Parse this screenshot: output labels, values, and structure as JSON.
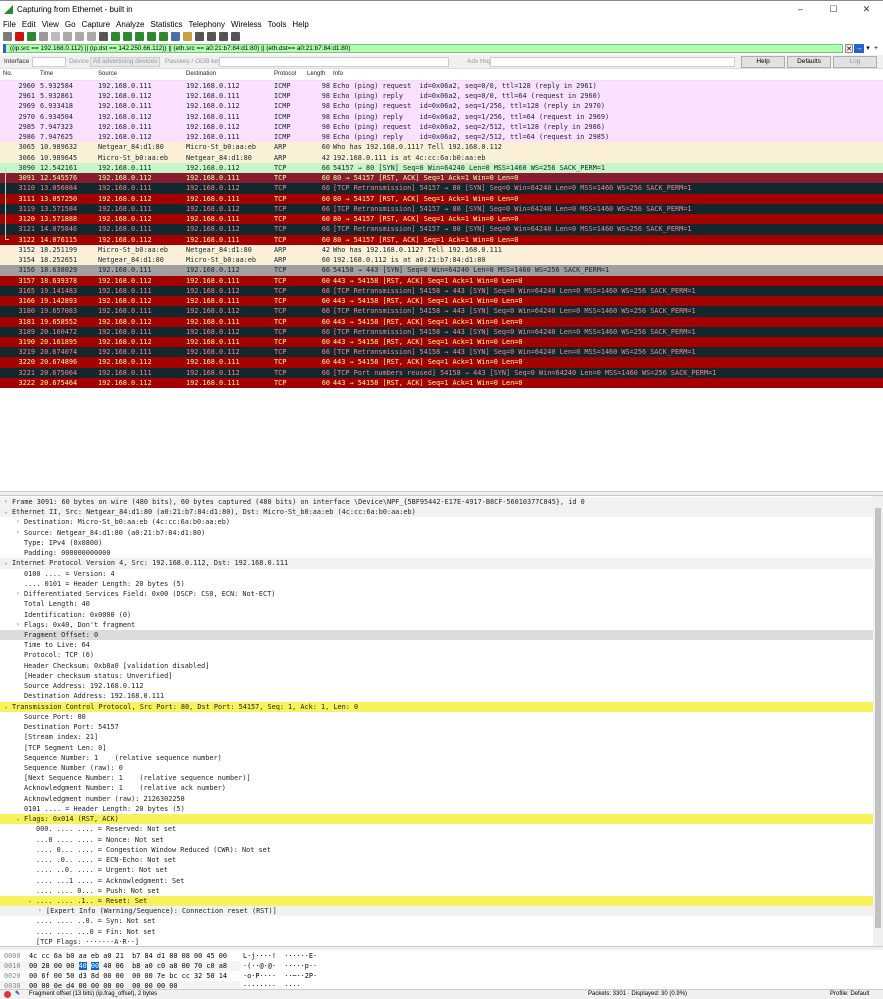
{
  "window": {
    "title": "Capturing from Ethernet - built in",
    "minimize": "–",
    "maximize": "☐",
    "close": "✕"
  },
  "menu": [
    "File",
    "Edit",
    "View",
    "Go",
    "Capture",
    "Analyze",
    "Statistics",
    "Telephony",
    "Wireless",
    "Tools",
    "Help"
  ],
  "toolbar_icons": [
    "shark-fin-start-icon",
    "stop-icon",
    "restart-icon",
    "options-icon",
    "open-icon",
    "save-icon",
    "close-file-icon",
    "reload-icon",
    "find-icon",
    "back-icon",
    "forward-icon",
    "go-to-packet-icon",
    "first-packet-icon",
    "last-packet-icon",
    "autoscroll-icon",
    "colorize-icon",
    "zoom-in-icon",
    "zoom-out-icon",
    "normal-size-icon",
    "resize-columns-icon"
  ],
  "filter": {
    "value": "((ip.src == 192.168.0.112) || (ip.dst == 142.250.66.112)) || (eth.src == a0:21:b7:84:d1:80) || (eth.dst== a0:21:b7:84:d1:80)",
    "clear": "✕",
    "apply": "→",
    "dropdown": "▾",
    "add": "+"
  },
  "interface_bar": {
    "interface_label": "Interface",
    "device_label": "Device",
    "device_value": "All advertising devices",
    "passkey_label": "Passkey / OOB key",
    "adv_hop_label": "Adv Hop",
    "help": "Help",
    "defaults": "Defaults",
    "log": "Log"
  },
  "columns": [
    "No.",
    "Time",
    "Source",
    "Destination",
    "Protocol",
    "Length",
    "Info"
  ],
  "packets": [
    {
      "no": "2960",
      "time": "5.932584",
      "src": "192.168.0.111",
      "dst": "192.168.0.112",
      "proto": "ICMP",
      "len": "98",
      "info": "Echo (ping) request  id=0x06a2, seq=0/0, ttl=128 (reply in 2961)",
      "type": "icmp"
    },
    {
      "no": "2961",
      "time": "5.932861",
      "src": "192.168.0.112",
      "dst": "192.168.0.111",
      "proto": "ICMP",
      "len": "98",
      "info": "Echo (ping) reply    id=0x06a2, seq=0/0, ttl=64 (request in 2960)",
      "type": "icmp"
    },
    {
      "no": "2969",
      "time": "6.933418",
      "src": "192.168.0.111",
      "dst": "192.168.0.112",
      "proto": "ICMP",
      "len": "98",
      "info": "Echo (ping) request  id=0x06a2, seq=1/256, ttl=128 (reply in 2970)",
      "type": "icmp"
    },
    {
      "no": "2970",
      "time": "6.934504",
      "src": "192.168.0.112",
      "dst": "192.168.0.111",
      "proto": "ICMP",
      "len": "98",
      "info": "Echo (ping) reply    id=0x06a2, seq=1/256, ttl=64 (request in 2969)",
      "type": "icmp"
    },
    {
      "no": "2985",
      "time": "7.947323",
      "src": "192.168.0.111",
      "dst": "192.168.0.112",
      "proto": "ICMP",
      "len": "98",
      "info": "Echo (ping) request  id=0x06a2, seq=2/512, ttl=128 (reply in 2986)",
      "type": "icmp"
    },
    {
      "no": "2986",
      "time": "7.947625",
      "src": "192.168.0.112",
      "dst": "192.168.0.111",
      "proto": "ICMP",
      "len": "98",
      "info": "Echo (ping) reply    id=0x06a2, seq=2/512, ttl=64 (request in 2985)",
      "type": "icmp"
    },
    {
      "no": "3065",
      "time": "10.989632",
      "src": "Netgear_84:d1:80",
      "dst": "Micro-St_b0:aa:eb",
      "proto": "ARP",
      "len": "60",
      "info": "Who has 192.168.0.111? Tell 192.168.0.112",
      "type": "arp"
    },
    {
      "no": "3066",
      "time": "10.989645",
      "src": "Micro-St_b0:aa:eb",
      "dst": "Netgear_84:d1:80",
      "proto": "ARP",
      "len": "42",
      "info": "192.168.0.111 is at 4c:cc:6a:b0:aa:eb",
      "type": "arp"
    },
    {
      "no": "3090",
      "time": "12.542161",
      "src": "192.168.0.111",
      "dst": "192.168.0.112",
      "proto": "TCP",
      "len": "66",
      "info": "54157 → 80 [SYN] Seq=0 Win=64240 Len=0 MSS=1460 WS=256 SACK_PERM=1",
      "type": "syn"
    },
    {
      "no": "3091",
      "time": "12.545576",
      "src": "192.168.0.112",
      "dst": "192.168.0.111",
      "proto": "TCP",
      "len": "60",
      "info": "80 → 54157 [RST, ACK] Seq=1 Ack=1 Win=0 Len=0",
      "type": "sel"
    },
    {
      "no": "3110",
      "time": "13.056884",
      "src": "192.168.0.111",
      "dst": "192.168.0.112",
      "proto": "TCP",
      "len": "66",
      "info": "[TCP Retransmission] 54157 → 80 [SYN] Seq=0 Win=64240 Len=0 MSS=1460 WS=256 SACK_PERM=1",
      "type": "retr"
    },
    {
      "no": "3111",
      "time": "13.057250",
      "src": "192.168.0.112",
      "dst": "192.168.0.111",
      "proto": "TCP",
      "len": "60",
      "info": "80 → 54157 [RST, ACK] Seq=1 Ack=1 Win=0 Len=0",
      "type": "rst"
    },
    {
      "no": "3119",
      "time": "13.571584",
      "src": "192.168.0.111",
      "dst": "192.168.0.112",
      "proto": "TCP",
      "len": "66",
      "info": "[TCP Retransmission] 54157 → 80 [SYN] Seq=0 Win=64240 Len=0 MSS=1460 WS=256 SACK_PERM=1",
      "type": "retr"
    },
    {
      "no": "3120",
      "time": "13.571888",
      "src": "192.168.0.112",
      "dst": "192.168.0.111",
      "proto": "TCP",
      "len": "60",
      "info": "80 → 54157 [RST, ACK] Seq=1 Ack=1 Win=0 Len=0",
      "type": "rst"
    },
    {
      "no": "3121",
      "time": "14.075846",
      "src": "192.168.0.111",
      "dst": "192.168.0.112",
      "proto": "TCP",
      "len": "66",
      "info": "[TCP Retransmission] 54157 → 80 [SYN] Seq=0 Win=64240 Len=0 MSS=1460 WS=256 SACK_PERM=1",
      "type": "retr"
    },
    {
      "no": "3122",
      "time": "14.076115",
      "src": "192.168.0.112",
      "dst": "192.168.0.111",
      "proto": "TCP",
      "len": "60",
      "info": "80 → 54157 [RST, ACK] Seq=1 Ack=1 Win=0 Len=0",
      "type": "rst"
    },
    {
      "no": "3152",
      "time": "18.251199",
      "src": "Micro-St_b0:aa:eb",
      "dst": "Netgear_84:d1:80",
      "proto": "ARP",
      "len": "42",
      "info": "Who has 192.168.0.112? Tell 192.168.0.111",
      "type": "arp"
    },
    {
      "no": "3154",
      "time": "18.252651",
      "src": "Netgear_84:d1:80",
      "dst": "Micro-St_b0:aa:eb",
      "proto": "ARP",
      "len": "60",
      "info": "192.168.0.112 is at a0:21:b7:84:d1:80",
      "type": "arp"
    },
    {
      "no": "3156",
      "time": "18.638029",
      "src": "192.168.0.111",
      "dst": "192.168.0.112",
      "proto": "TCP",
      "len": "66",
      "info": "54158 → 443 [SYN] Seq=0 Win=64240 Len=0 MSS=1460 WS=256 SACK_PERM=1",
      "type": "grey"
    },
    {
      "no": "3157",
      "time": "18.639378",
      "src": "192.168.0.112",
      "dst": "192.168.0.111",
      "proto": "TCP",
      "len": "60",
      "info": "443 → 54158 [RST, ACK] Seq=1 Ack=1 Win=0 Len=0",
      "type": "rst"
    },
    {
      "no": "3165",
      "time": "19.141483",
      "src": "192.168.0.111",
      "dst": "192.168.0.112",
      "proto": "TCP",
      "len": "66",
      "info": "[TCP Retransmission] 54158 → 443 [SYN] Seq=0 Win=64240 Len=0 MSS=1460 WS=256 SACK_PERM=1",
      "type": "retr"
    },
    {
      "no": "3166",
      "time": "19.142893",
      "src": "192.168.0.112",
      "dst": "192.168.0.111",
      "proto": "TCP",
      "len": "60",
      "info": "443 → 54158 [RST, ACK] Seq=1 Ack=1 Win=0 Len=0",
      "type": "rst"
    },
    {
      "no": "3180",
      "time": "19.657083",
      "src": "192.168.0.111",
      "dst": "192.168.0.112",
      "proto": "TCP",
      "len": "66",
      "info": "[TCP Retransmission] 54158 → 443 [SYN] Seq=0 Win=64240 Len=0 MSS=1460 WS=256 SACK_PERM=1",
      "type": "retr"
    },
    {
      "no": "3181",
      "time": "19.658552",
      "src": "192.168.0.112",
      "dst": "192.168.0.111",
      "proto": "TCP",
      "len": "60",
      "info": "443 → 54158 [RST, ACK] Seq=1 Ack=1 Win=0 Len=0",
      "type": "rst"
    },
    {
      "no": "3189",
      "time": "20.160472",
      "src": "192.168.0.111",
      "dst": "192.168.0.112",
      "proto": "TCP",
      "len": "66",
      "info": "[TCP Retransmission] 54158 → 443 [SYN] Seq=0 Win=64240 Len=0 MSS=1460 WS=256 SACK_PERM=1",
      "type": "retr"
    },
    {
      "no": "3190",
      "time": "20.161895",
      "src": "192.168.0.112",
      "dst": "192.168.0.111",
      "proto": "TCP",
      "len": "60",
      "info": "443 → 54158 [RST, ACK] Seq=1 Ack=1 Win=0 Len=0",
      "type": "rst"
    },
    {
      "no": "3219",
      "time": "20.674074",
      "src": "192.168.0.111",
      "dst": "192.168.0.112",
      "proto": "TCP",
      "len": "66",
      "info": "[TCP Retransmission] 54158 → 443 [SYN] Seq=0 Win=64240 Len=0 MSS=1460 WS=256 SACK_PERM=1",
      "type": "retr"
    },
    {
      "no": "3220",
      "time": "20.674896",
      "src": "192.168.0.112",
      "dst": "192.168.0.111",
      "proto": "TCP",
      "len": "60",
      "info": "443 → 54158 [RST, ACK] Seq=1 Ack=1 Win=0 Len=0",
      "type": "rst"
    },
    {
      "no": "3221",
      "time": "20.675064",
      "src": "192.168.0.111",
      "dst": "192.168.0.112",
      "proto": "TCP",
      "len": "66",
      "info": "[TCP Port numbers reused] 54158 → 443 [SYN] Seq=0 Win=64240 Len=0 MSS=1460 WS=256 SACK_PERM=1",
      "type": "retr"
    },
    {
      "no": "3222",
      "time": "20.675464",
      "src": "192.168.0.112",
      "dst": "192.168.0.111",
      "proto": "TCP",
      "len": "60",
      "info": "443 → 54158 [RST, ACK] Seq=1 Ack=1 Win=0 Len=0",
      "type": "rst"
    }
  ],
  "details": [
    {
      "text": "Frame 3091: 60 bytes on wire (480 bits), 60 bytes captured (480 bits) on interface \\Device\\NPF_{5BF95442-E17E-4917-B8CF-56010377C845}, id 0",
      "level": 0,
      "exp": ">",
      "style": "hdr"
    },
    {
      "text": "Ethernet II, Src: Netgear_84:d1:80 (a0:21:b7:84:d1:80), Dst: Micro-St_b0:aa:eb (4c:cc:6a:b0:aa:eb)",
      "level": 0,
      "exp": "v",
      "style": "hdr"
    },
    {
      "text": "Destination: Micro-St_b0:aa:eb (4c:cc:6a:b0:aa:eb)",
      "level": 1,
      "exp": ">"
    },
    {
      "text": "Source: Netgear_84:d1:80 (a0:21:b7:84:d1:80)",
      "level": 1,
      "exp": ">"
    },
    {
      "text": "Type: IPv4 (0x0800)",
      "level": 1
    },
    {
      "text": "Padding: 000000000000",
      "level": 1
    },
    {
      "text": "Internet Protocol Version 4, Src: 192.168.0.112, Dst: 192.168.0.111",
      "level": 0,
      "exp": "v",
      "style": "hdr"
    },
    {
      "text": "0100 .... = Version: 4",
      "level": 1
    },
    {
      "text": ".... 0101 = Header Length: 20 bytes (5)",
      "level": 1
    },
    {
      "text": "Differentiated Services Field: 0x00 (DSCP: CS0, ECN: Not-ECT)",
      "level": 1,
      "exp": ">"
    },
    {
      "text": "Total Length: 40",
      "level": 1
    },
    {
      "text": "Identification: 0x0000 (0)",
      "level": 1
    },
    {
      "text": "Flags: 0x40, Don't fragment",
      "level": 1,
      "exp": ">"
    },
    {
      "text": "Fragment Offset: 0",
      "level": 1,
      "style": "sel"
    },
    {
      "text": "Time to Live: 64",
      "level": 1
    },
    {
      "text": "Protocol: TCP (6)",
      "level": 1
    },
    {
      "text": "Header Checksum: 0xb8a0 [validation disabled]",
      "level": 1
    },
    {
      "text": "[Header checksum status: Unverified]",
      "level": 1
    },
    {
      "text": "Source Address: 192.168.0.112",
      "level": 1
    },
    {
      "text": "Destination Address: 192.168.0.111",
      "level": 1
    },
    {
      "text": "Transmission Control Protocol, Src Port: 80, Dst Port: 54157, Seq: 1, Ack: 1, Len: 0",
      "level": 0,
      "exp": "v",
      "style": "yel"
    },
    {
      "text": "Source Port: 80",
      "level": 1
    },
    {
      "text": "Destination Port: 54157",
      "level": 1
    },
    {
      "text": "[Stream index: 21]",
      "level": 1
    },
    {
      "text": "[TCP Segment Len: 0]",
      "level": 1
    },
    {
      "text": "Sequence Number: 1    (relative sequence number)",
      "level": 1
    },
    {
      "text": "Sequence Number (raw): 0",
      "level": 1
    },
    {
      "text": "[Next Sequence Number: 1    (relative sequence number)]",
      "level": 1
    },
    {
      "text": "Acknowledgment Number: 1    (relative ack number)",
      "level": 1
    },
    {
      "text": "Acknowledgment number (raw): 2126302258",
      "level": 1
    },
    {
      "text": "0101 .... = Header Length: 20 bytes (5)",
      "level": 1
    },
    {
      "text": "Flags: 0x014 (RST, ACK)",
      "level": 1,
      "exp": "v",
      "style": "yel"
    },
    {
      "text": "000. .... .... = Reserved: Not set",
      "level": 2
    },
    {
      "text": "...0 .... .... = Nonce: Not set",
      "level": 2
    },
    {
      "text": ".... 0... .... = Congestion Window Reduced (CWR): Not set",
      "level": 2
    },
    {
      "text": ".... .0.. .... = ECN-Echo: Not set",
      "level": 2
    },
    {
      "text": ".... ..0. .... = Urgent: Not set",
      "level": 2
    },
    {
      "text": ".... ...1 .... = Acknowledgment: Set",
      "level": 2
    },
    {
      "text": ".... .... 0... = Push: Not set",
      "level": 2
    },
    {
      "text": ".... .... .1.. = Reset: Set",
      "level": 2,
      "exp": "v",
      "style": "yel"
    },
    {
      "text": "[Expert Info (Warning/Sequence): Connection reset (RST)]",
      "level": 3,
      "exp": ">",
      "style": "hdr"
    },
    {
      "text": ".... .... ..0. = Syn: Not set",
      "level": 2
    },
    {
      "text": ".... .... ...0 = Fin: Not set",
      "level": 2
    },
    {
      "text": "[TCP Flags: ·······A·R··]",
      "level": 2
    }
  ],
  "bytes": [
    {
      "offset": "0000",
      "hex": [
        "4c",
        "cc",
        "6a",
        "b0",
        "aa",
        "eb",
        "a0",
        "21",
        "b7",
        "84",
        "d1",
        "80",
        "08",
        "00",
        "45",
        "00"
      ],
      "ascii": "L·j····!  ······E·"
    },
    {
      "offset": "0010",
      "hex": [
        "00",
        "28",
        "00",
        "00",
        "40",
        "00",
        "40",
        "06",
        "b8",
        "a0",
        "c0",
        "a8",
        "00",
        "70",
        "c0",
        "a8"
      ],
      "ascii": "·(··@·@·  ·····p··",
      "highlight": [
        4,
        5
      ]
    },
    {
      "offset": "0020",
      "hex": [
        "00",
        "6f",
        "00",
        "50",
        "d3",
        "8d",
        "00",
        "00",
        "00",
        "00",
        "7e",
        "bc",
        "cc",
        "32",
        "50",
        "14"
      ],
      "ascii": "·o·P····  ··~··2P·"
    },
    {
      "offset": "0030",
      "hex": [
        "00",
        "00",
        "0e",
        "d4",
        "00",
        "00",
        "00",
        "00",
        "00",
        "00",
        "00",
        "00"
      ],
      "ascii": "········  ····"
    }
  ],
  "status": {
    "field": "Fragment offset (13 bits) (ip.frag_offset), 2 bytes",
    "packets": "Packets: 3301 · Displayed: 30 (0.9%)",
    "profile": "Profile: Default"
  },
  "colors": {
    "filter_ok": "#afffaf",
    "rst_bg": "#a40000",
    "rst_fg": "#fffc9c",
    "retrans_bg": "#12272e",
    "retrans_fg": "#f78787",
    "icmp_bg": "#fce0ff",
    "arp_bg": "#faf0d7",
    "syn_bg": "#c8f5c8",
    "highlight": "#f5f25e"
  }
}
